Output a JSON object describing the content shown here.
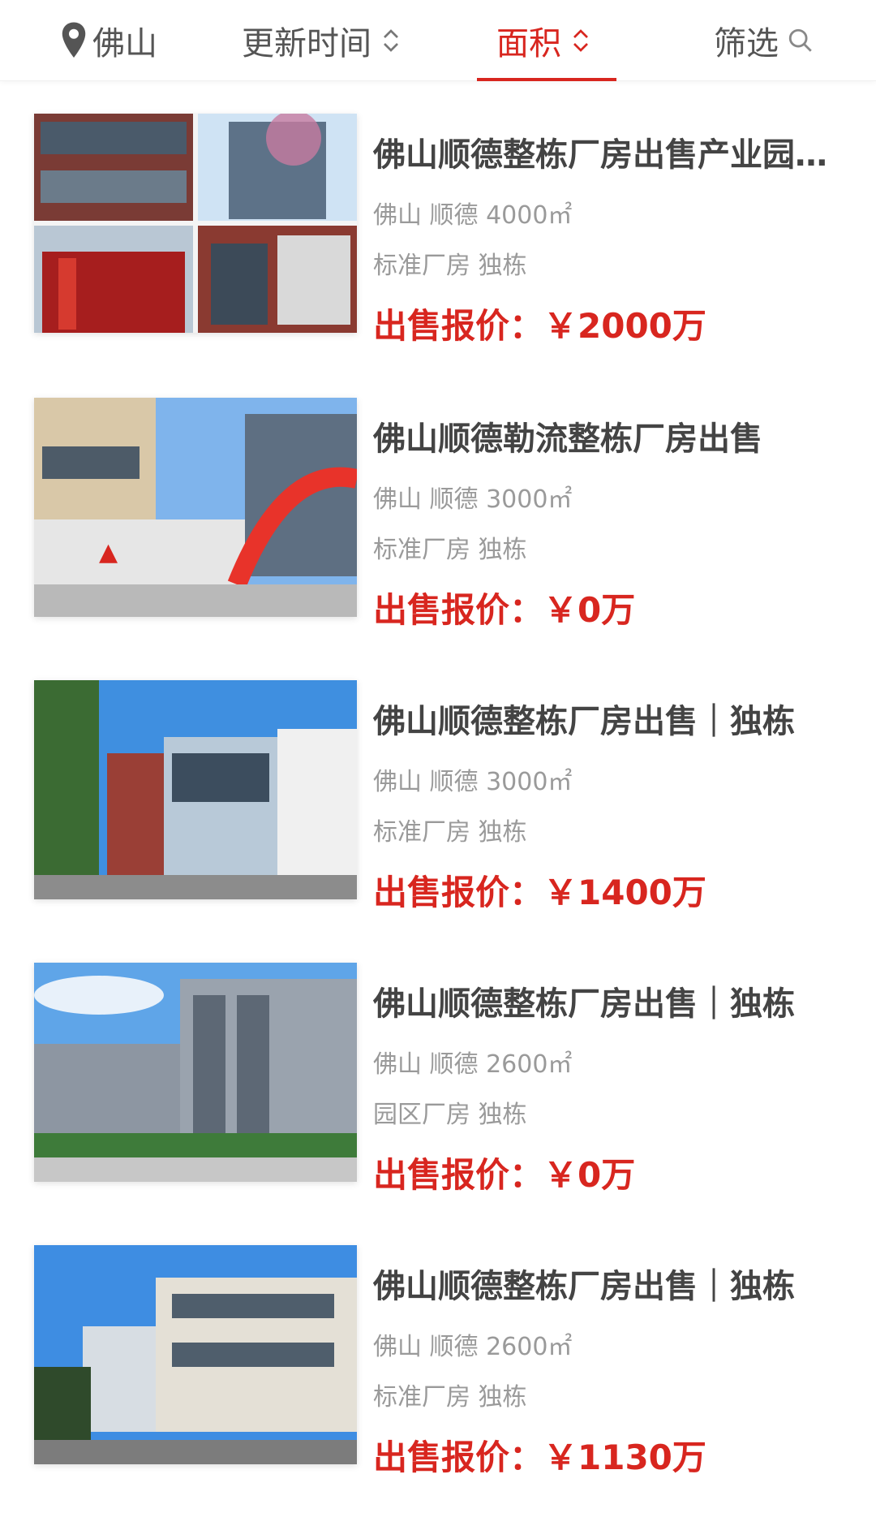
{
  "filter_bar": {
    "city": "佛山",
    "sort_update": "更新时间",
    "sort_area": "面积",
    "filter": "筛选",
    "accent_color": "#d8261f"
  },
  "listings": [
    {
      "title": "佛山顺德整栋厂房出售产业园独栋",
      "location": "佛山 顺德 4000㎡",
      "tags": "标准厂房 独栋",
      "price_label": "出售报价：",
      "price": "￥2000万"
    },
    {
      "title": "佛山顺德勒流整栋厂房出售",
      "location": "佛山 顺德 3000㎡",
      "tags": "标准厂房 独栋",
      "price_label": "出售报价：",
      "price": "￥0万"
    },
    {
      "title": "佛山顺德整栋厂房出售｜独栋",
      "location": "佛山 顺德 3000㎡",
      "tags": "标准厂房 独栋",
      "price_label": "出售报价：",
      "price": "￥1400万"
    },
    {
      "title": "佛山顺德整栋厂房出售｜独栋",
      "location": "佛山 顺德 2600㎡",
      "tags": "园区厂房 独栋",
      "price_label": "出售报价：",
      "price": "￥0万"
    },
    {
      "title": "佛山顺德整栋厂房出售｜独栋",
      "location": "佛山 顺德 2600㎡",
      "tags": "标准厂房 独栋",
      "price_label": "出售报价：",
      "price": "￥1130万"
    }
  ]
}
